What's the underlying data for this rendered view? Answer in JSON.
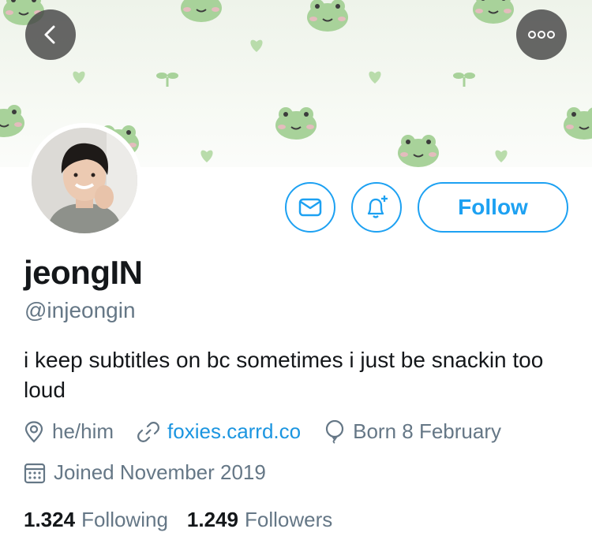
{
  "profile": {
    "display_name": "jeongIN",
    "handle": "@injeongin",
    "bio": "i keep subtitles on bc sometimes i just be snackin too loud",
    "pronouns": "he/him",
    "website": "foxies.carrd.co",
    "birthday": "Born 8 February",
    "joined": "Joined November 2019"
  },
  "actions": {
    "follow_label": "Follow"
  },
  "stats": {
    "following_count": "1.324",
    "following_label": "Following",
    "followers_count": "1.249",
    "followers_label": "Followers"
  },
  "colors": {
    "accent": "#1da1f2",
    "link": "#1b95e0",
    "muted_text": "#657786",
    "frog_green": "#a8d29a"
  },
  "icons": {
    "back": "chevron-left-icon",
    "more": "ellipsis-icon",
    "message": "envelope-icon",
    "notify": "bell-plus-icon",
    "pronouns": "location-pin-icon",
    "website": "link-icon",
    "birthday": "balloon-icon",
    "joined": "calendar-icon"
  }
}
